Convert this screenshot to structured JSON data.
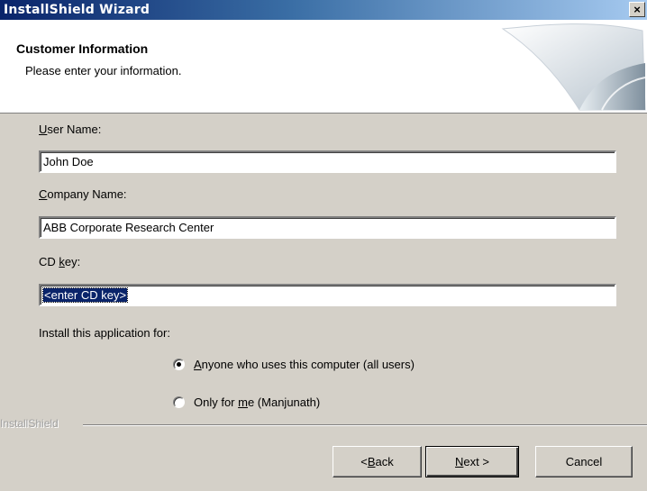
{
  "window": {
    "title": "InstallShield Wizard",
    "close_glyph": "×"
  },
  "header": {
    "title": "Customer Information",
    "subtitle": "Please enter your information."
  },
  "form": {
    "user_name": {
      "label_mnemonic": "U",
      "label_rest": "ser Name:",
      "value": "John Doe"
    },
    "company_name": {
      "label_mnemonic": "C",
      "label_rest": "ompany Name:",
      "value": "ABB Corporate Research Center"
    },
    "cd_key": {
      "label_prefix": "CD ",
      "label_mnemonic": "k",
      "label_rest": "ey:",
      "value": "<enter CD key>"
    },
    "install_for": {
      "label": "Install this application for:",
      "options": [
        {
          "mnemonic": "A",
          "rest": "nyone who uses this computer (all users)",
          "checked": true
        },
        {
          "prefix": "Only for ",
          "mnemonic": "m",
          "rest": "e (Manjunath)",
          "checked": false
        }
      ]
    }
  },
  "footer": {
    "brand": "InstallShield",
    "back": {
      "prefix": "< ",
      "mnemonic": "B",
      "rest": "ack"
    },
    "next": {
      "mnemonic": "N",
      "rest": "ext >"
    },
    "cancel": "Cancel"
  }
}
